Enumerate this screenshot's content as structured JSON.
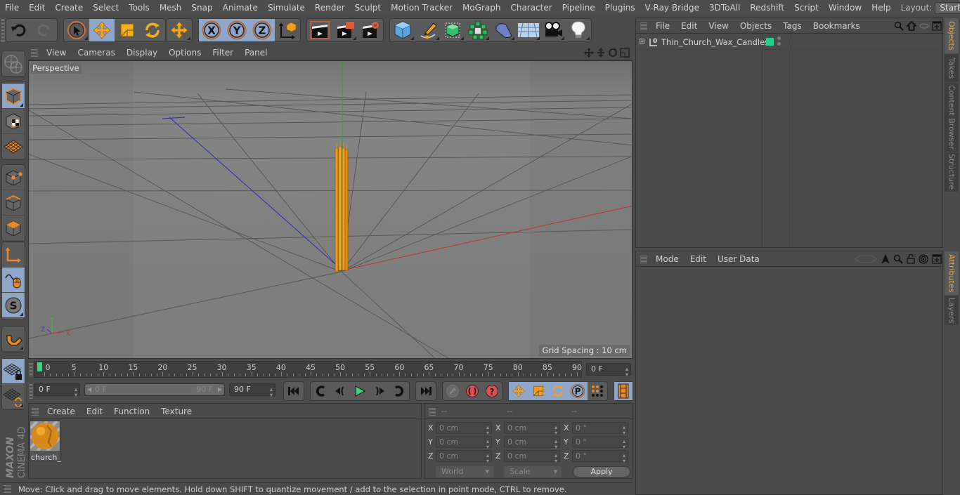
{
  "menubar": {
    "items": [
      "File",
      "Edit",
      "Create",
      "Select",
      "Tools",
      "Mesh",
      "Snap",
      "Animate",
      "Simulate",
      "Render",
      "Sculpt",
      "Motion Tracker",
      "MoGraph",
      "Character",
      "Pipeline",
      "Plugins",
      "V-Ray Bridge",
      "3DToAll",
      "Redshift",
      "Script",
      "Window",
      "Help"
    ],
    "layout_label": "Layout:",
    "layout_value": "Startup"
  },
  "toolbar": {
    "groups": [
      {
        "buttons": [
          {
            "icon": "undo-icon",
            "active": false
          },
          {
            "icon": "redo-icon",
            "active": false,
            "disabled": true
          }
        ]
      },
      {
        "buttons": [
          {
            "icon": "live-selection-icon",
            "active": false
          },
          {
            "icon": "move-icon",
            "active": true
          },
          {
            "icon": "scale-icon",
            "active": false
          },
          {
            "icon": "rotate-icon",
            "active": false
          }
        ]
      },
      {
        "buttons": [
          {
            "icon": "recent-tools-icon",
            "active": false
          }
        ]
      },
      {
        "buttons": [
          {
            "icon": "x-axis-icon",
            "label": "X",
            "active": true
          },
          {
            "icon": "y-axis-icon",
            "label": "Y",
            "active": true
          },
          {
            "icon": "z-axis-icon",
            "label": "Z",
            "active": true
          },
          {
            "icon": "coordinate-system-icon",
            "active": false
          }
        ]
      },
      {
        "buttons": [
          {
            "icon": "render-view-icon"
          },
          {
            "icon": "render-picture-viewer-icon"
          },
          {
            "icon": "render-settings-icon"
          }
        ]
      },
      {
        "buttons": [
          {
            "icon": "cube-icon"
          },
          {
            "icon": "pen-spline-icon"
          },
          {
            "icon": "subdivision-surface-icon"
          },
          {
            "icon": "cloner-icon"
          },
          {
            "icon": "deformer-icon"
          },
          {
            "icon": "floor-icon"
          },
          {
            "icon": "camera-icon"
          },
          {
            "icon": "light-icon"
          }
        ]
      }
    ]
  },
  "left_toolbar": {
    "items": [
      "make-editable-icon",
      "model-mode-icon",
      "texture-mode-icon",
      "workplane-mode-icon",
      "points-mode-icon",
      "edges-mode-icon",
      "polygons-mode-icon",
      "axis-mode-icon",
      "tweak-mode-icon",
      "solo-icon",
      "snap-icon",
      "workplane-lock-icon",
      "workplane-align-icon"
    ]
  },
  "viewport": {
    "menu": [
      "View",
      "Cameras",
      "Display",
      "Options",
      "Filter",
      "Panel"
    ],
    "camera_label": "Perspective",
    "grid_spacing": "Grid Spacing : 10 cm",
    "axis_labels": {
      "x": "X",
      "y": "Y",
      "z": "Z"
    }
  },
  "timeline": {
    "ticks": [
      "0",
      "5",
      "10",
      "15",
      "20",
      "25",
      "30",
      "35",
      "40",
      "45",
      "50",
      "55",
      "60",
      "65",
      "70",
      "75",
      "80",
      "85",
      "90"
    ],
    "current_frame": "0 F",
    "start_field": "0 F",
    "range_start": "0 F",
    "range_end": "90 F",
    "end_field": "90 F",
    "playhead_frame": 0
  },
  "materials": {
    "menu": [
      "Create",
      "Edit",
      "Function",
      "Texture"
    ],
    "items": [
      {
        "name": "church_"
      }
    ]
  },
  "coordinates": {
    "headers": [
      "--",
      "--",
      "--"
    ],
    "rows": [
      {
        "axis": "X",
        "pos": "0 cm",
        "size": "0 cm",
        "rot": "0 °"
      },
      {
        "axis": "Y",
        "pos": "0 cm",
        "size": "0 cm",
        "rot": "0 °"
      },
      {
        "axis": "Z",
        "pos": "0 cm",
        "size": "0 cm",
        "rot": "0 °"
      }
    ],
    "mode_select": "World",
    "type_select": "Scale",
    "apply_label": "Apply"
  },
  "objects_panel": {
    "menu": [
      "File",
      "Edit",
      "View",
      "Objects",
      "Tags",
      "Bookmarks"
    ],
    "objects": [
      {
        "name": "Thin_Church_Wax_Candles",
        "color": "#25d08a"
      }
    ]
  },
  "attributes_panel": {
    "menu": [
      "Mode",
      "Edit",
      "User Data"
    ]
  },
  "right_tabs": {
    "top": [
      {
        "label": "Objects",
        "active": true
      },
      {
        "label": "Takes",
        "active": false
      },
      {
        "label": "Content Browser",
        "active": false
      },
      {
        "label": "Structure",
        "active": false
      }
    ],
    "bottom": [
      {
        "label": "Attributes",
        "active": true
      },
      {
        "label": "Layers",
        "active": false
      }
    ]
  },
  "status_bar": {
    "text": "Move: Click and drag to move elements. Hold down SHIFT to quantize movement / add to the selection in point mode, CTRL to remove."
  },
  "brand": {
    "line1": "MAXON",
    "line2": "CINEMA 4D"
  },
  "colors": {
    "accent": "#8ea6c9",
    "tab_active": "#e9a640",
    "playhead": "#3ed180",
    "candle": "#f0a020"
  }
}
